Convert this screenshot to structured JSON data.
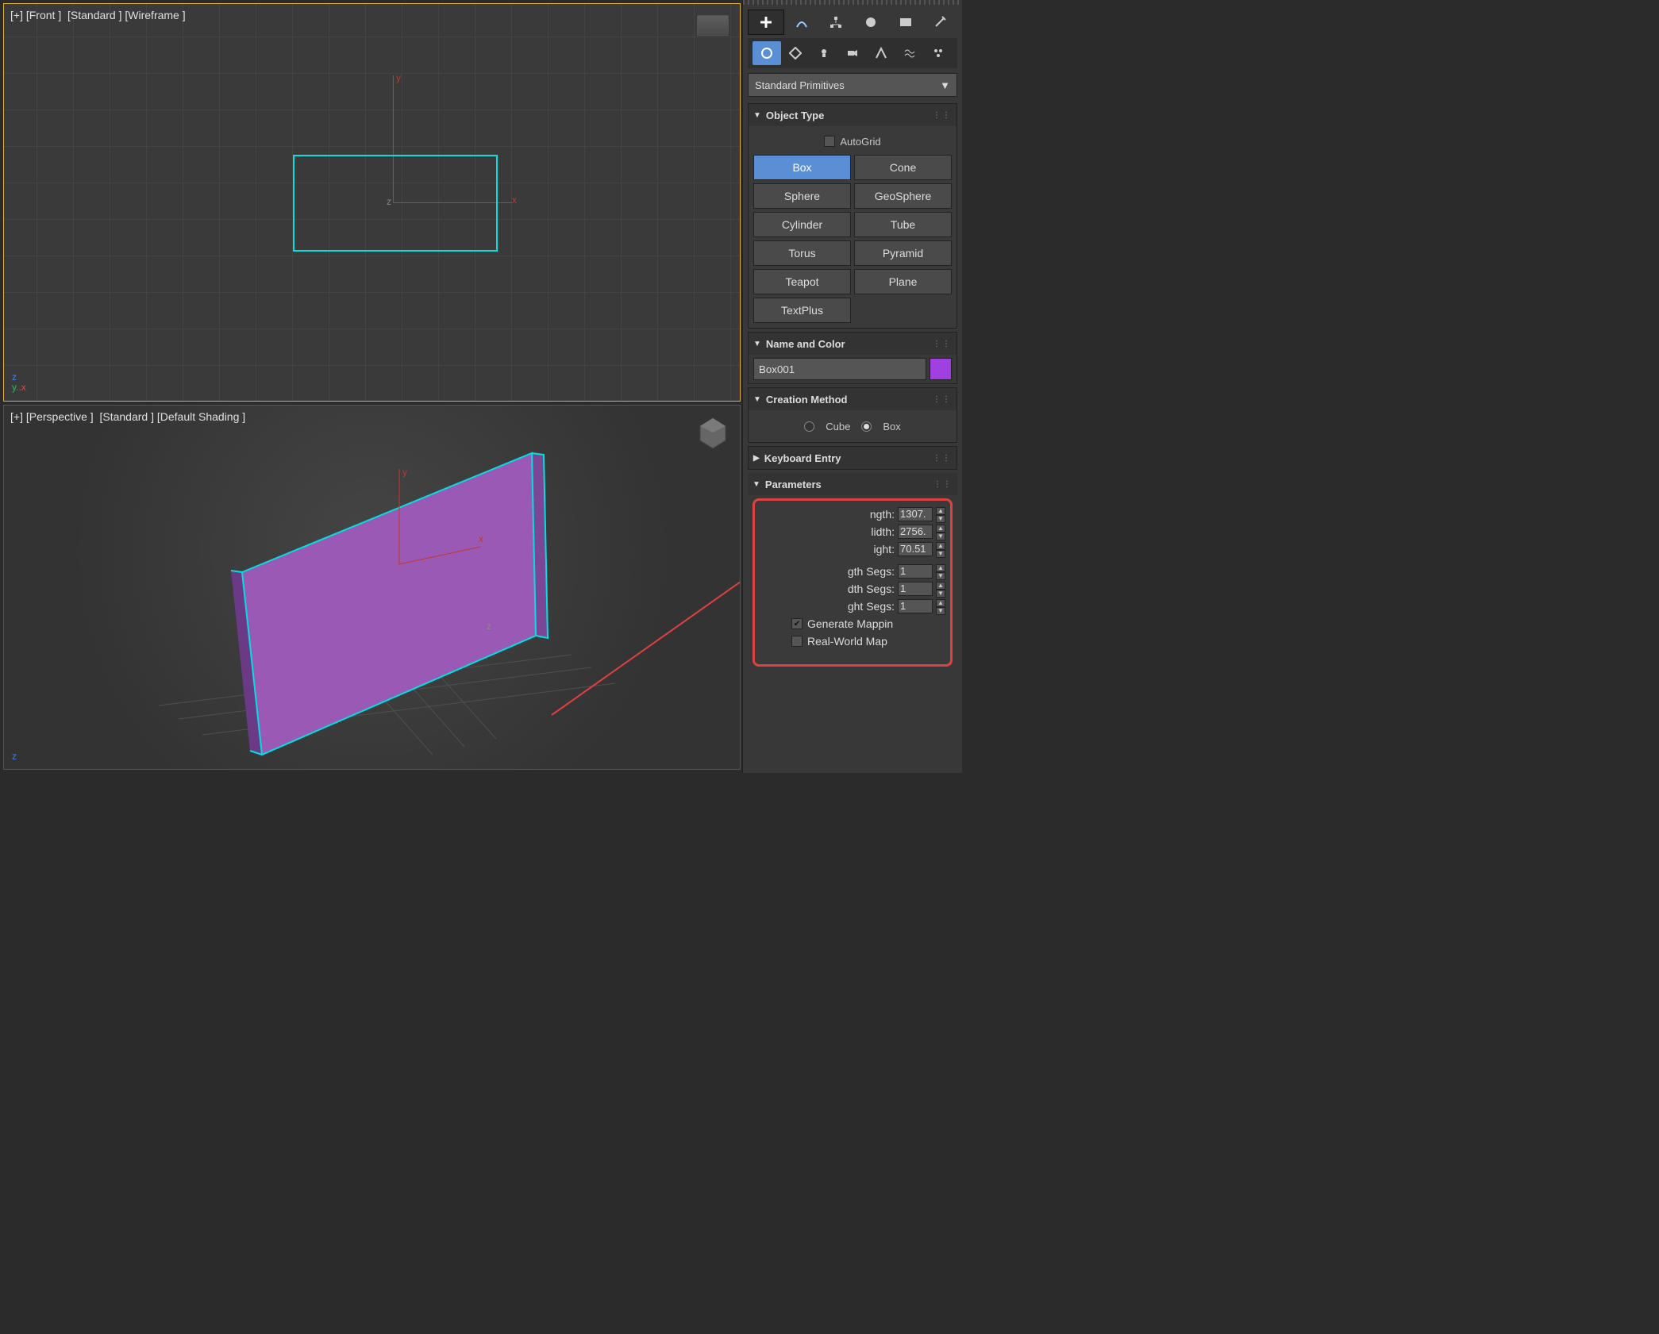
{
  "viewportTop": {
    "labels": [
      "[+]",
      "[Front ]",
      "[Standard ]",
      "[Wireframe ]"
    ],
    "axis": {
      "x": "x",
      "y": "y",
      "z": "z"
    },
    "cornerGizmo": {
      "z": "z",
      "y": "y",
      "x": "x"
    }
  },
  "viewportBottom": {
    "labels": [
      "[+]",
      "[Perspective ]",
      "[Standard ]",
      "[Default Shading ]"
    ],
    "axis": {
      "x": "x",
      "y": "y",
      "z": "z"
    },
    "cornerGizmo": {
      "z": "z"
    }
  },
  "panel": {
    "dropdown": "Standard Primitives",
    "rollouts": {
      "objectType": {
        "title": "Object Type",
        "autogrid": "AutoGrid",
        "buttons": [
          "Box",
          "Cone",
          "Sphere",
          "GeoSphere",
          "Cylinder",
          "Tube",
          "Torus",
          "Pyramid",
          "Teapot",
          "Plane",
          "TextPlus"
        ]
      },
      "nameColor": {
        "title": "Name and Color",
        "name": "Box001",
        "color": "#a040e0"
      },
      "creationMethod": {
        "title": "Creation Method",
        "options": [
          "Cube",
          "Box"
        ],
        "selected": "Box"
      },
      "keyboardEntry": {
        "title": "Keyboard Entry"
      },
      "parameters": {
        "title": "Parameters",
        "rows": [
          {
            "label": "ngth:",
            "value": "1307."
          },
          {
            "label": "lidth:",
            "value": "2756."
          },
          {
            "label": "ight:",
            "value": "70.51"
          },
          {
            "label": "gth Segs:",
            "value": "1"
          },
          {
            "label": "dth Segs:",
            "value": "1"
          },
          {
            "label": "ght Segs:",
            "value": "1"
          }
        ],
        "checks": [
          {
            "label": "Generate Mappin",
            "checked": true
          },
          {
            "label": "Real-World Map",
            "checked": false
          }
        ]
      }
    }
  }
}
